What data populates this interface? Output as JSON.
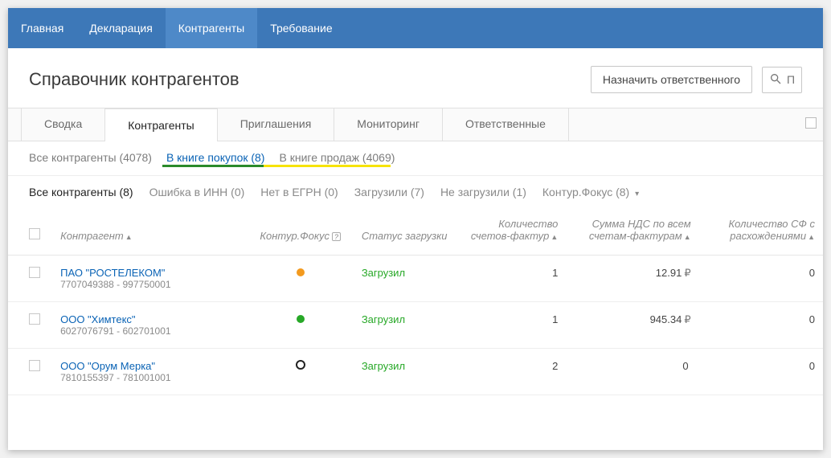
{
  "nav": {
    "items": [
      {
        "label": "Главная"
      },
      {
        "label": "Декларация"
      },
      {
        "label": "Контрагенты",
        "active": true
      },
      {
        "label": "Требование"
      }
    ]
  },
  "page": {
    "title": "Справочник контрагентов",
    "assign_btn": "Назначить ответственного",
    "search_placeholder": "П"
  },
  "tabs": [
    {
      "label": "Сводка"
    },
    {
      "label": "Контрагенты",
      "active": true
    },
    {
      "label": "Приглашения"
    },
    {
      "label": "Мониторинг"
    },
    {
      "label": "Ответственные"
    }
  ],
  "filters1": [
    {
      "label": "Все контрагенты (4078)"
    },
    {
      "label": "В книге покупок (8)",
      "active": true
    },
    {
      "label": "В книге продаж (4069)"
    }
  ],
  "filters2": [
    {
      "label": "Все контрагенты (8)",
      "active": true
    },
    {
      "label": "Ошибка в ИНН (0)"
    },
    {
      "label": "Нет в ЕГРН (0)"
    },
    {
      "label": "Загрузили (7)"
    },
    {
      "label": "Не загрузили (1)"
    },
    {
      "label": "Контур.Фокус (8)",
      "dropdown": true
    }
  ],
  "table": {
    "headers": {
      "contragent": "Контрагент",
      "focus": "Контур.Фокус",
      "status": "Статус загрузки",
      "count": "Количество счетов-фактур",
      "sum": "Сумма НДС по всем счетам-фактурам",
      "discrep": "Количество СФ с расхождениями"
    },
    "rows": [
      {
        "name": "ПАО \"РОСТЕЛЕКОМ\"",
        "id": "7707049388 - 997750001",
        "focus": "orange",
        "status": "Загрузил",
        "count": "1",
        "sum": "12.91",
        "currency": "₽",
        "discrep": "0"
      },
      {
        "name": "ООО \"Химтекс\"",
        "id": "6027076791 - 602701001",
        "focus": "green",
        "status": "Загрузил",
        "count": "1",
        "sum": "945.34",
        "currency": "₽",
        "discrep": "0"
      },
      {
        "name": "ООО \"Орум Мерка\"",
        "id": "7810155397 - 781001001",
        "focus": "ring",
        "status": "Загрузил",
        "count": "2",
        "sum": "0",
        "currency": "",
        "discrep": "0"
      }
    ]
  }
}
